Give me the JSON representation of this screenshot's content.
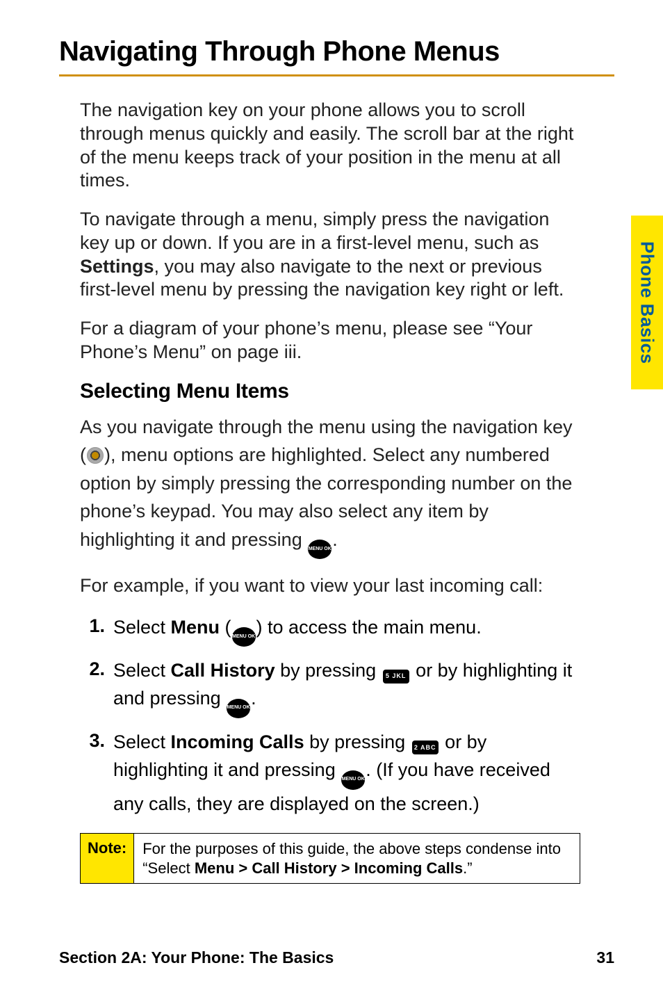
{
  "heading1": "Navigating Through Phone Menus",
  "sideTab": "Phone Basics",
  "para1": "The navigation key on your phone allows you to scroll through menus quickly and easily. The scroll bar at the right of the menu keeps track of your position in the menu at all times.",
  "para2a": "To navigate through a menu, simply press the navigation key up or down. If you are in a first-level menu, such as ",
  "para2_bold": "Settings",
  "para2b": ", you may also navigate to the next or previous first-level menu by pressing the navigation key right or left.",
  "para3": "For a diagram of your phone’s menu, please see “Your Phone’s Menu” on page iii.",
  "heading2": "Selecting Menu Items",
  "para4a": "As you navigate through the menu using the navigation key (",
  "para4b": "), menu options are highlighted. Select any numbered option by simply pressing the corresponding number on the phone’s keypad. You may also select any item by highlighting it and pressing ",
  "para4c": ".",
  "para5": "For example, if you want to view your last incoming call:",
  "steps": [
    {
      "num": "1.",
      "prefix": "Select ",
      "bold1": "Menu",
      "mid1": " (",
      "iconA": "menu",
      "mid2": ") to access the main menu.",
      "suffix": ""
    },
    {
      "num": "2.",
      "prefix": "Select ",
      "bold1": "Call History",
      "mid1": " by pressing ",
      "iconA": "key5",
      "mid2": " or by highlighting it and pressing ",
      "iconB": "menu",
      "suffix": "."
    },
    {
      "num": "3.",
      "prefix": "Select ",
      "bold1": "Incoming Calls",
      "mid1": " by pressing ",
      "iconA": "key2",
      "mid2": " or by highlighting it and pressing ",
      "iconB": "menu",
      "suffix": ". (If you have received any calls, they are displayed on the screen.)"
    }
  ],
  "note": {
    "label": "Note:",
    "body_a": "For the purposes of this guide, the above steps condense into “Select ",
    "body_bold": "Menu > Call History > Incoming Calls",
    "body_b": ".”"
  },
  "footer": {
    "left": "Section 2A: Your Phone: The Basics",
    "right": "31"
  },
  "icons": {
    "menu_label": "MENU\nOK",
    "key5_label": "5 JKL",
    "key2_label": "2 ABC"
  }
}
